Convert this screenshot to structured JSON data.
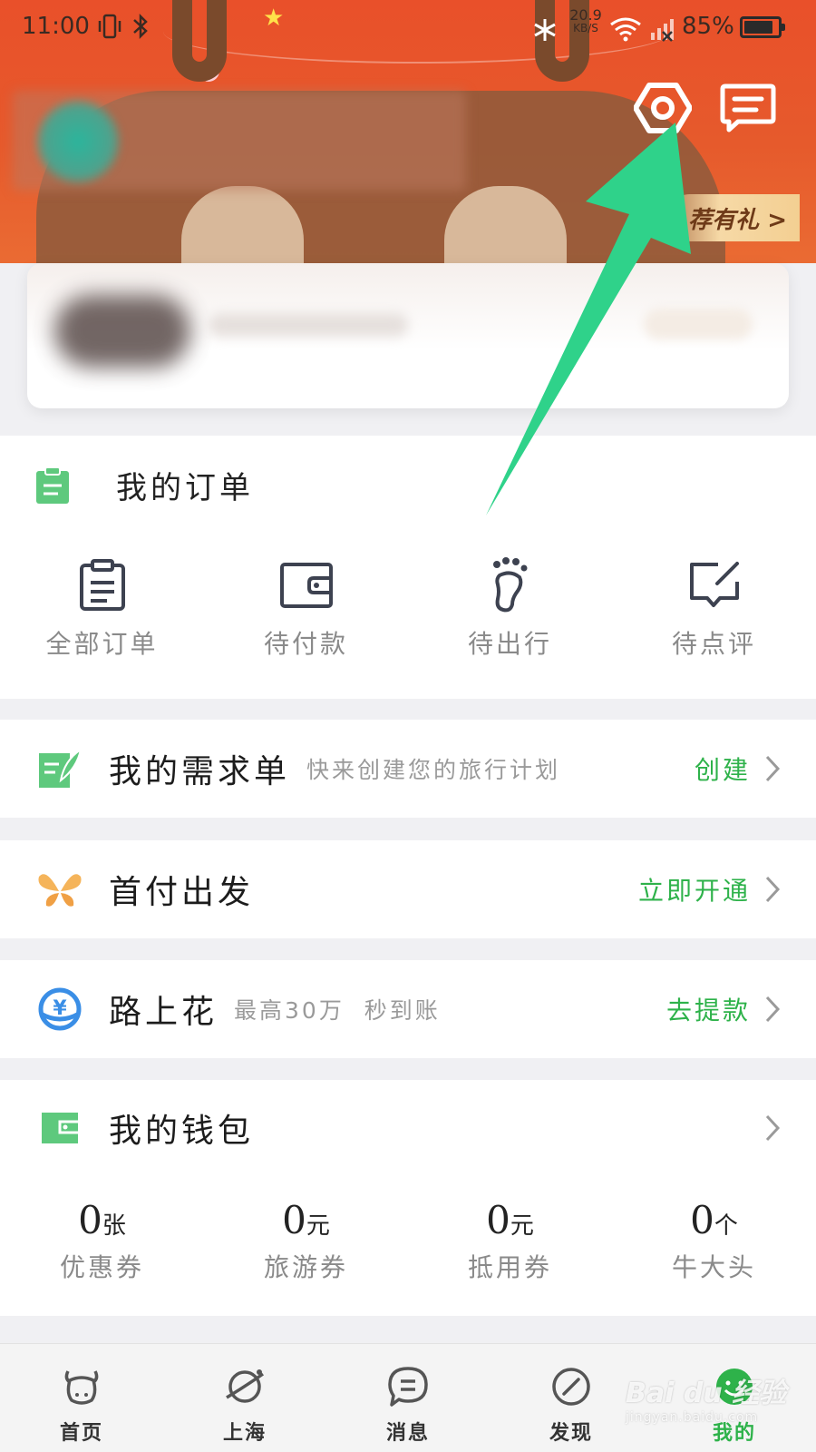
{
  "status_bar": {
    "time": "11:00",
    "net_speed_value": "20.9",
    "net_speed_unit": "KB/S",
    "battery_text": "85%",
    "battery_level": 0.85
  },
  "header": {
    "settings_icon": "settings-hexagon-icon",
    "message_icon": "message-icon",
    "recommend_label": "推荐有礼",
    "recommend_visible_label": "荐有礼 >"
  },
  "orders": {
    "title": "我的订单",
    "items": [
      {
        "label": "全部订单",
        "icon": "clipboard-icon"
      },
      {
        "label": "待付款",
        "icon": "wallet-icon"
      },
      {
        "label": "待出行",
        "icon": "footprint-icon"
      },
      {
        "label": "待点评",
        "icon": "comment-edit-icon"
      }
    ]
  },
  "demand": {
    "title": "我的需求单",
    "subtitle": "快来创建您的旅行计划",
    "action": "创建"
  },
  "shoufu": {
    "title": "首付出发",
    "action": "立即开通"
  },
  "lushang": {
    "title": "路上花",
    "subtitle": "最高30万  秒到账",
    "action": "去提款"
  },
  "wallet": {
    "title": "我的钱包",
    "items": [
      {
        "value": "0",
        "unit": "张",
        "label": "优惠券"
      },
      {
        "value": "0",
        "unit": "元",
        "label": "旅游券"
      },
      {
        "value": "0",
        "unit": "元",
        "label": "抵用券"
      },
      {
        "value": "0",
        "unit": "个",
        "label": "牛大头"
      }
    ]
  },
  "tabs": [
    {
      "label": "首页",
      "icon": "cow-head-icon"
    },
    {
      "label": "上海",
      "icon": "planet-icon"
    },
    {
      "label": "消息",
      "icon": "chat-bubble-icon"
    },
    {
      "label": "发现",
      "icon": "compass-icon"
    },
    {
      "label": "我的",
      "icon": "smiley-icon",
      "active": true
    }
  ],
  "watermark": {
    "main": "Bai du 经验",
    "sub": "jingyan.baidu.com"
  },
  "colors": {
    "accent": "#2eb24a",
    "banner": "#e9502a",
    "arrow": "#2ecf8a"
  }
}
